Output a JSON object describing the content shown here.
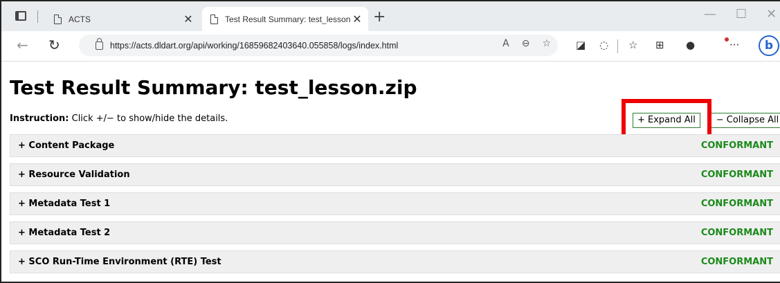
{
  "browser": {
    "tabs": [
      {
        "title": "ACTS",
        "close": "✕"
      },
      {
        "title": "Test Result Summary: test_lesson",
        "close": "✕"
      }
    ],
    "new_tab": "+",
    "window_controls": {
      "minimize": "—",
      "maximize": "☐",
      "close": "✕"
    },
    "url": "https://acts.dldart.org/api/working/16859682403640.055858/logs/index.html",
    "nav_icons": {
      "back": "back-arrow-icon",
      "reload": "reload-icon"
    }
  },
  "page": {
    "title": "Test Result Summary: test_lesson.zip",
    "instruction_label": "Instruction:",
    "instruction_text": " Click +/− to show/hide the details.",
    "expand_all": "+ Expand All",
    "collapse_all": "− Collapse All",
    "sections": [
      {
        "label": "+ Content Package",
        "status": "CONFORMANT"
      },
      {
        "label": "+ Resource Validation",
        "status": "CONFORMANT"
      },
      {
        "label": "+ Metadata Test 1",
        "status": "CONFORMANT"
      },
      {
        "label": "+ Metadata Test 2",
        "status": "CONFORMANT"
      },
      {
        "label": "+ SCO Run-Time Environment (RTE) Test",
        "status": "CONFORMANT"
      }
    ]
  },
  "colors": {
    "status": "#1a8a1a",
    "highlight": "#ee0000",
    "section_bg": "#efefef"
  }
}
